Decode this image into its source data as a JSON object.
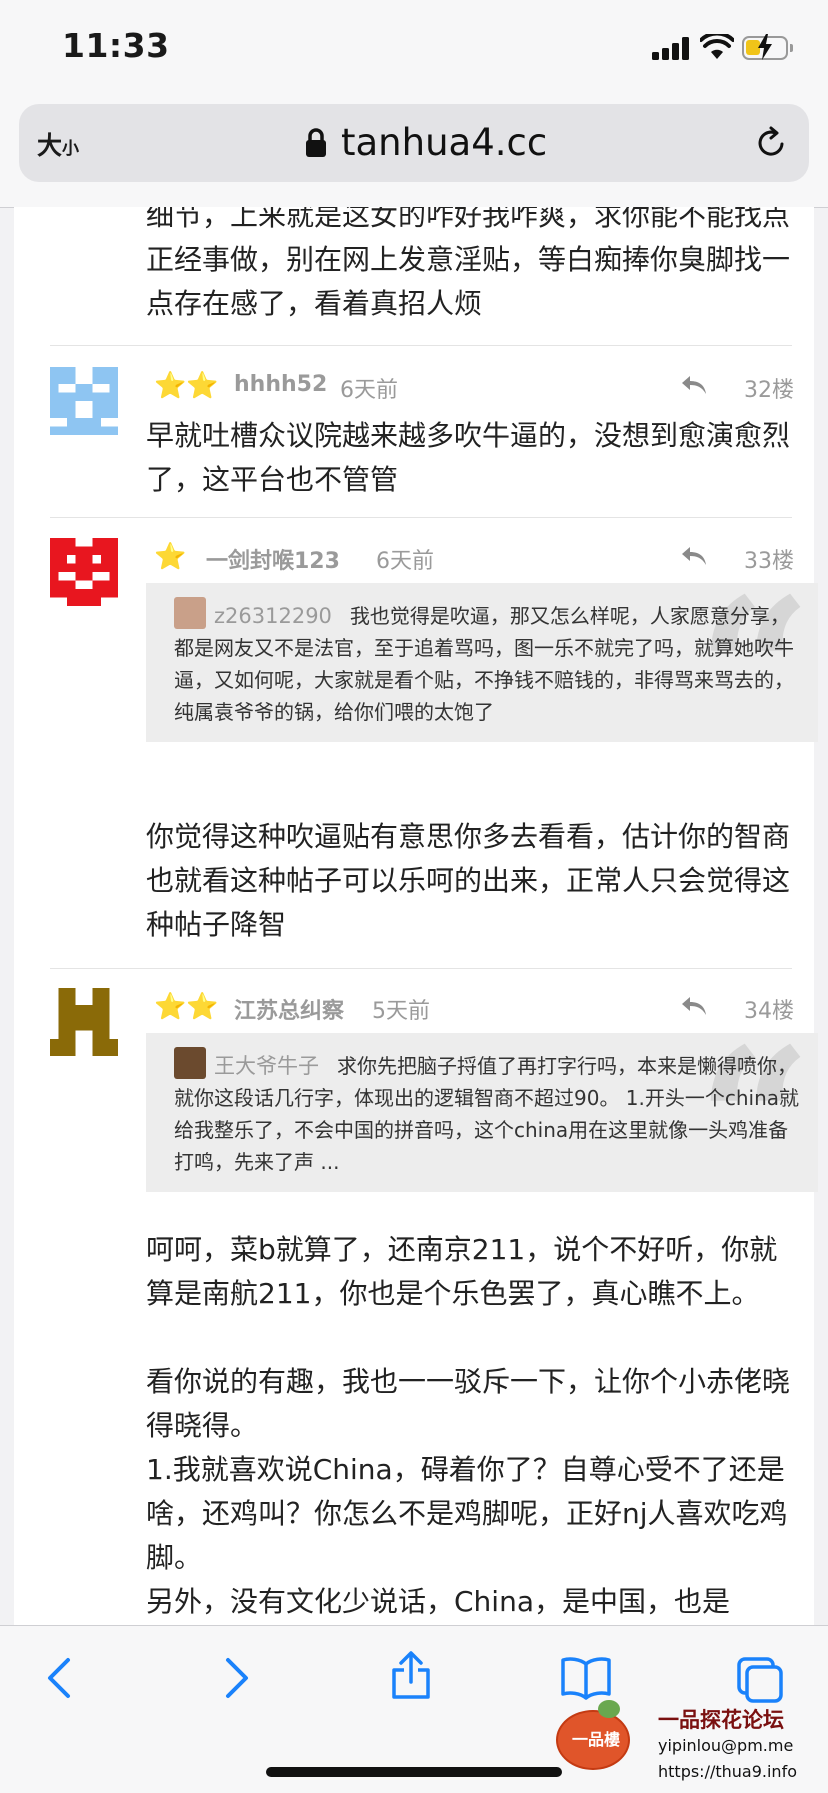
{
  "status_bar": {
    "time": "11:33"
  },
  "browser": {
    "text_size_label_big": "大",
    "text_size_label_small": "小",
    "url": "tanhua4.cc"
  },
  "page": {
    "prev_post_text": "细节，上来就是这女的咋好我咋爽，求你能不能找点正经事做，别在网上发意淫贴，等白痴捧你臭脚找一点存在感了，看着真招人烦",
    "posts": [
      {
        "stars": "⭐⭐",
        "user": "hhhh52",
        "time_ago": "6天前",
        "floor": "32楼",
        "text": "早就吐槽众议院越来越多吹牛逼的，没想到愈演愈烈了，这平台也不管管"
      },
      {
        "stars": "⭐",
        "user": "一剑封喉123",
        "time_ago": "6天前",
        "floor": "33楼",
        "quote_user": "z26312290",
        "quote_text": "我也觉得是吹逼，那又怎么样呢，人家愿意分享，都是网友又不是法官，至于追着骂吗，图一乐不就完了吗，就算她吹牛逼，又如何呢，大家就是看个贴，不挣钱不赔钱的，非得骂来骂去的，纯属袁爷爷的锅，给你们喂的太饱了",
        "text": "你觉得这种吹逼贴有意思你多去看看，估计你的智商也就看这种帖子可以乐呵的出来，正常人只会觉得这种帖子降智"
      },
      {
        "stars": "⭐⭐",
        "user": "江苏总纠察",
        "time_ago": "5天前",
        "floor": "34楼",
        "quote_user": "王大爷牛子",
        "quote_text": "求你先把脑子捋值了再打字行吗，本来是懒得喷你，就你这段话几行字，体现出的逻辑智商不超过90。 1.开头一个china就给我整乐了，不会中国的拼音吗，这个china用在这里就像一头鸡准备打鸣，先来了声 ...",
        "text_lines": [
          "呵呵，菜b就算了，还南京211，说个不好听，你就算是南航211，你也是个乐色罢了，真心瞧不上。",
          "看你说的有趣，我也一一驳斥一下，让你个小赤佬晓得晓得。",
          "1.我就喜欢说China，碍着你了？自尊心受不了还是啥，还鸡叫？你怎么不是鸡脚呢，正好nj人喜欢吃鸡脚。",
          "另外，没有文化少说话，China，是中国，也是"
        ]
      }
    ]
  },
  "toolbar": {
    "back": "back-icon",
    "forward": "forward-icon",
    "share": "share-icon",
    "bookmarks": "book-icon",
    "tabs": "tabs-icon"
  },
  "watermark": {
    "logo_text": "一品樓",
    "title": "一品探花论坛",
    "email": "yipinlou@pm.me",
    "site": "https://thua9.info"
  },
  "colors": {
    "star": "#f1c232",
    "meta_gray": "#9a9a9a",
    "toolbar_blue": "#1a82fb"
  }
}
